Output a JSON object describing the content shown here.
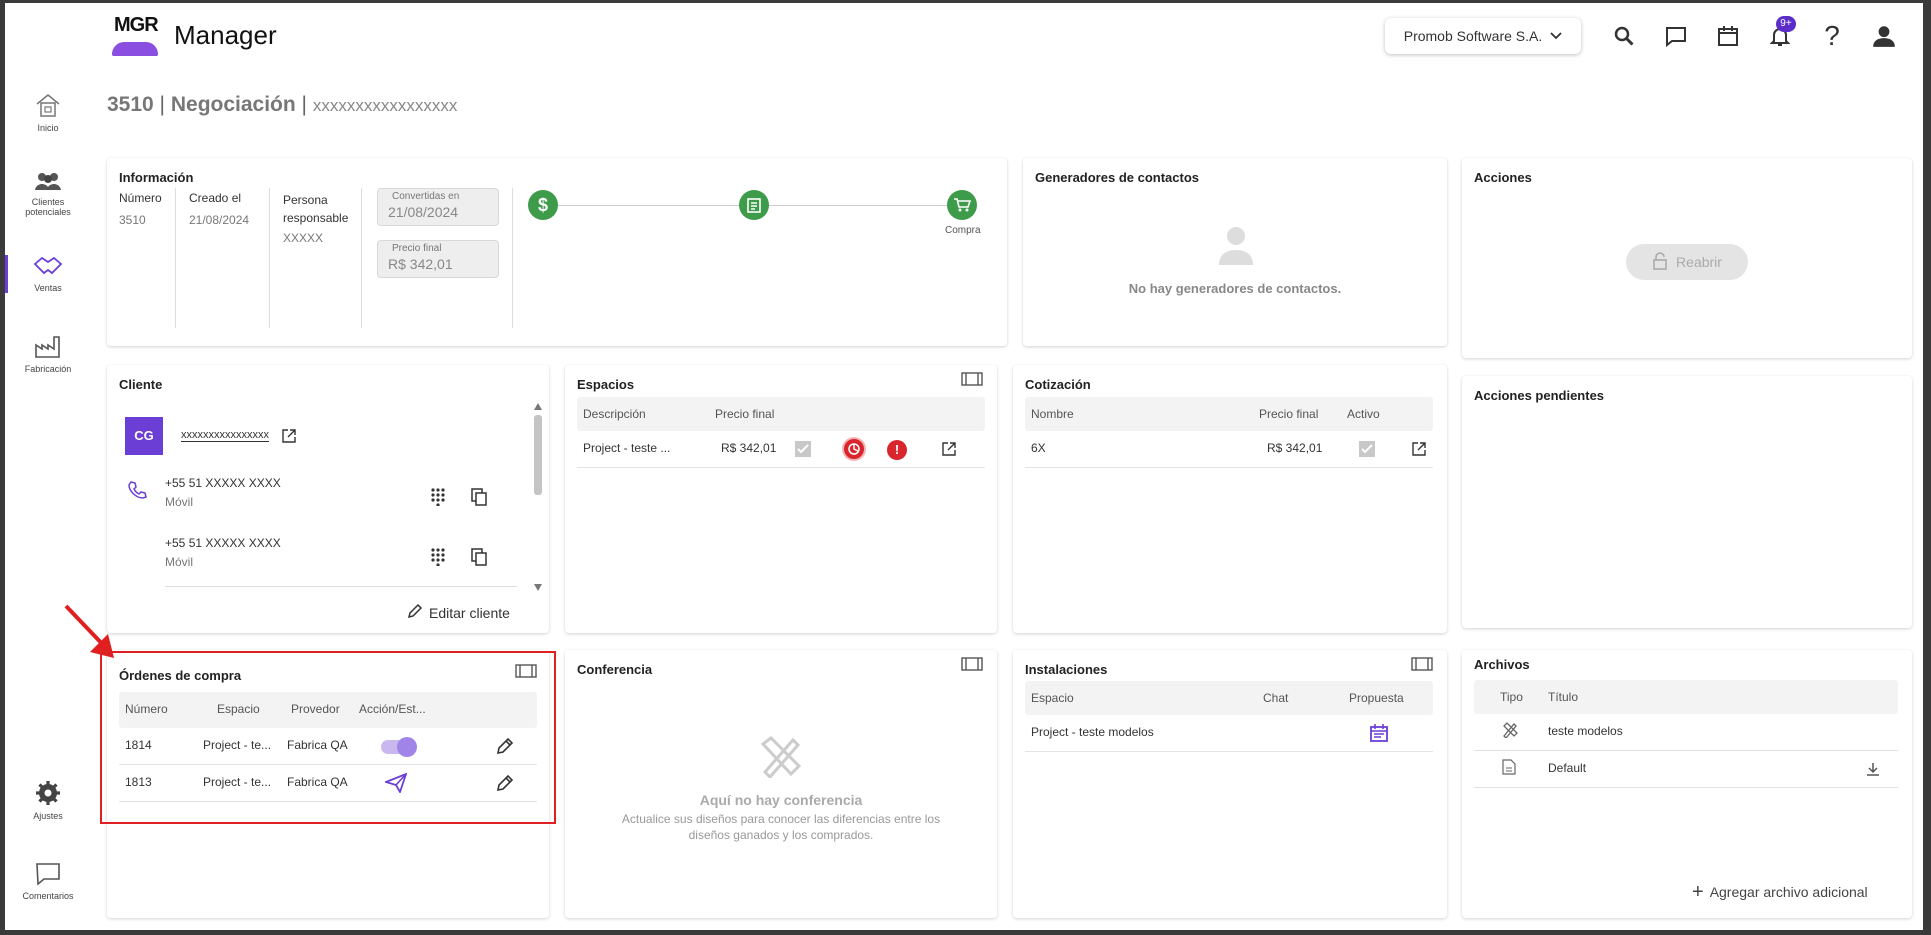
{
  "app": {
    "logo_text": "MGR",
    "title": "Manager"
  },
  "header": {
    "company": "Promob Software S.A.",
    "notification_badge": "9+"
  },
  "sidebar": {
    "items": [
      {
        "label": "Inicio"
      },
      {
        "label": "Clientes potenciales"
      },
      {
        "label": "Ventas"
      },
      {
        "label": "Fabricación"
      }
    ],
    "bottom": [
      {
        "label": "Ajustes"
      },
      {
        "label": "Comentarios"
      }
    ]
  },
  "page": {
    "number": "3510",
    "sep": " | ",
    "type": "Negociación",
    "sep2": " | ",
    "client_name": "xxxxxxxxxxxxxxxxx"
  },
  "info": {
    "title": "Información",
    "col1_label": "Número",
    "col1_value": "3510",
    "col2_label": "Creado el",
    "col2_value": "21/08/2024",
    "col3_label": "Persona responsable",
    "col3_value": "XXXXX",
    "converted_label": "Convertidas en",
    "converted_value": "21/08/2024",
    "price_label": "Precio final",
    "price_value": "R$ 342,01",
    "stepper_last_label": "Compra"
  },
  "generators": {
    "title": "Generadores de contactos",
    "empty": "No hay generadores de contactos."
  },
  "actions": {
    "title": "Acciones",
    "reopen": "Reabrir"
  },
  "pending": {
    "title": "Acciones pendientes"
  },
  "client": {
    "title": "Cliente",
    "avatar": "CG",
    "name": "xxxxxxxxxxxxxxxx",
    "phones": [
      {
        "number": "+55 51 XXXXX XXXX",
        "type": "Móvil"
      },
      {
        "number": "+55 51 XXXXX XXXX",
        "type": "Móvil"
      }
    ],
    "edit": "Editar cliente"
  },
  "spaces": {
    "title": "Espacios",
    "headers": [
      "Descripción",
      "Precio final"
    ],
    "rows": [
      {
        "desc": "Project - teste ...",
        "price": "R$ 342,01"
      }
    ]
  },
  "quote": {
    "title": "Cotización",
    "headers": [
      "Nombre",
      "Precio final",
      "Activo"
    ],
    "rows": [
      {
        "name": "6X",
        "price": "R$ 342,01"
      }
    ]
  },
  "orders": {
    "title": "Órdenes de compra",
    "headers": [
      "Número",
      "Espacio",
      "Provedor",
      "Acción/Est..."
    ],
    "rows": [
      {
        "number": "1814",
        "space": "Project - te...",
        "provider": "Fabrica QA"
      },
      {
        "number": "1813",
        "space": "Project - te...",
        "provider": "Fabrica QA"
      }
    ]
  },
  "conference": {
    "title": "Conferencia",
    "empty_title": "Aquí no hay conferencia",
    "empty_text": "Actualice sus diseños para conocer las diferencias entre los diseños ganados y los comprados."
  },
  "installs": {
    "title": "Instalaciones",
    "headers": [
      "Espacio",
      "Chat",
      "Propuesta"
    ],
    "rows": [
      {
        "space": "Project - teste modelos"
      }
    ]
  },
  "files": {
    "title": "Archivos",
    "headers": [
      "Tipo",
      "Título"
    ],
    "rows": [
      {
        "title": "teste modelos"
      },
      {
        "title": "Default"
      }
    ],
    "add": "Agregar archivo adicional"
  },
  "colors": {
    "accent": "#6b3fd6",
    "green": "#3d9b4a",
    "red": "#d9262c",
    "highlight": "#e02020"
  }
}
